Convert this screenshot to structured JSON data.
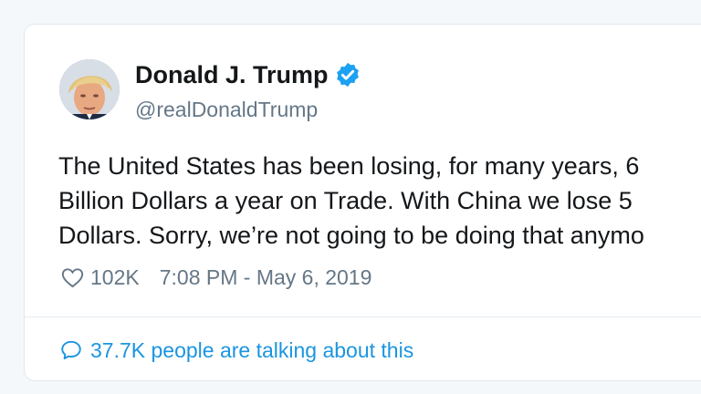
{
  "tweet": {
    "author": {
      "display_name": "Donald J. Trump",
      "handle": "@realDonaldTrump",
      "verified": true,
      "avatar_icon": "profile-photo"
    },
    "text_lines": [
      "The United States has been losing, for many years, 6",
      "Billion Dollars a year on Trade. With China we lose 5",
      "Dollars. Sorry, we’re not going to be doing that anymo"
    ],
    "likes": "102K",
    "timestamp": "7:08 PM - May 6, 2019",
    "talking_about": "37.7K people are talking about this",
    "icons": {
      "like": "heart-icon",
      "comments": "speech-bubble-icon",
      "verified": "verified-badge-icon"
    },
    "colors": {
      "link_blue": "#1b95e0",
      "verified_blue": "#1da1f2",
      "text": "#14171a",
      "muted": "#657786"
    }
  }
}
